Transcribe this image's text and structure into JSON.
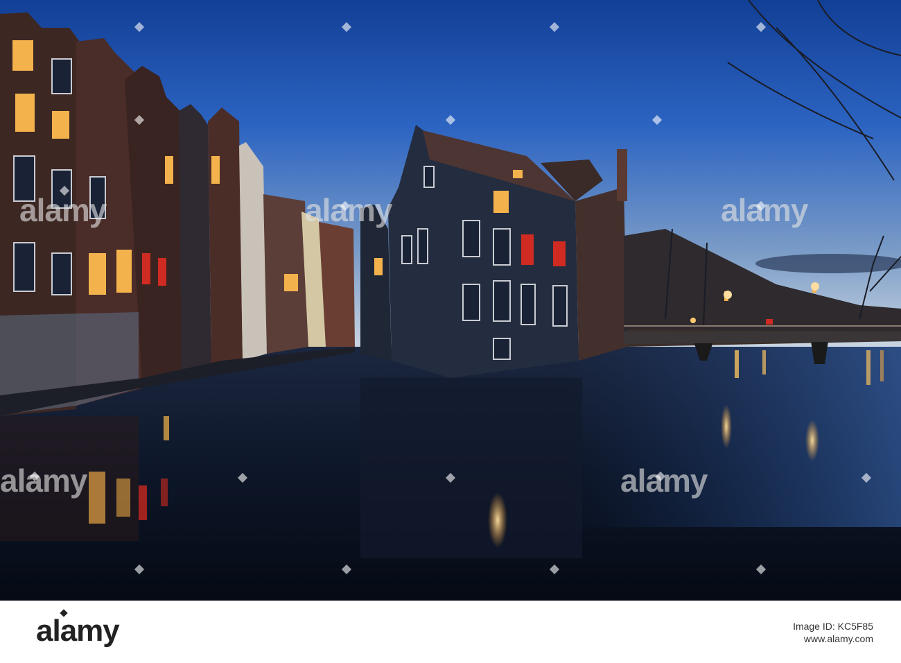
{
  "image": {
    "description_colors": {
      "sky_top": "#1e4fa8",
      "sky_mid": "#2f67c4",
      "sky_horizon": "#c9d6e2",
      "water": "#0b1a33",
      "building_dark": "#242b3d",
      "building_brick": "#4a2f2a",
      "window_glow": "#f5b64a",
      "red_light": "#d42a1f"
    }
  },
  "watermark": {
    "text": "alamy"
  },
  "footer": {
    "logo": "alamy",
    "image_id": "Image ID: KC5F85",
    "url": "www.alamy.com"
  }
}
